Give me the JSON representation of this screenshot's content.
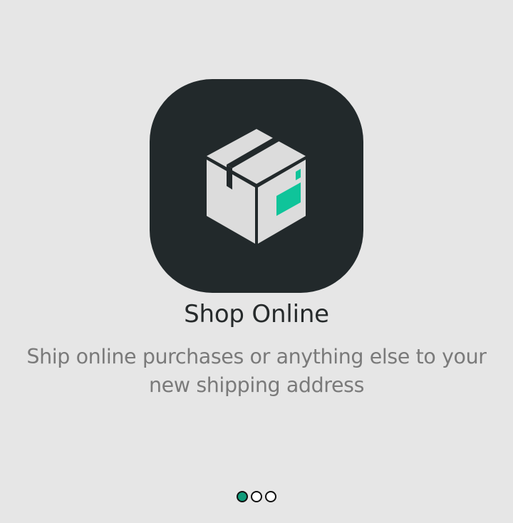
{
  "onboarding": {
    "icon": "package-box-icon",
    "title": "Shop Online",
    "description": "Ship online purchases or anything else to your new shipping address"
  },
  "pager": {
    "total": 3,
    "active_index": 0
  },
  "colors": {
    "background": "#e6e6e6",
    "icon_tile": "#22292b",
    "accent": "#0fc49a",
    "active_dot": "#0f9b7a",
    "title": "#262a2b",
    "description": "#7a7a7a"
  }
}
